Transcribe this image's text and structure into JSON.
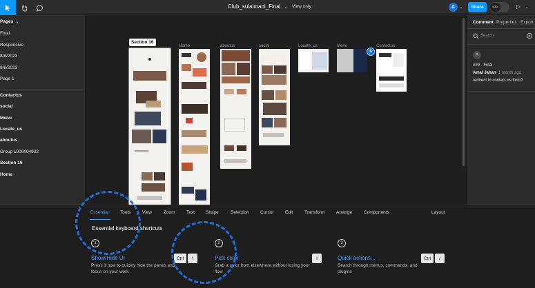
{
  "toolbar": {
    "file_title": "Club_sulaimani_Final",
    "view_mode": "View only",
    "avatar_initial": "A",
    "share_label": "Share",
    "code_icon_text": "</>",
    "accent_color": "#0d99ff"
  },
  "left_panel": {
    "pages_header": "Pages",
    "pages": [
      "Final",
      "Responsive",
      "8/8/2023",
      "9/8/2023",
      "Page 1"
    ],
    "layers": [
      "Contactus",
      "social",
      "Menu",
      "Locate_us",
      "aboutus",
      "Group 1000004932",
      "Section 16",
      "Home"
    ]
  },
  "canvas": {
    "frames": [
      {
        "label": "Section 16",
        "selected": true
      },
      {
        "label": "Home"
      },
      {
        "label": "aboutus"
      },
      {
        "label": "social"
      },
      {
        "label": "Locate_us"
      },
      {
        "label": "Menu"
      },
      {
        "label": "Contactus"
      }
    ],
    "cursor_avatar": "A"
  },
  "right_panel": {
    "tabs": [
      "Comment",
      "Properties",
      "Export"
    ],
    "search_placeholder": "Search",
    "comment": {
      "avatar": "A",
      "ref": "#29 · Final",
      "author": "Amal Jahan",
      "time": "1 month ago",
      "message": "redirect to contact us form?"
    }
  },
  "shortcuts_panel": {
    "tabs": [
      "Essential",
      "Tools",
      "View",
      "Zoom",
      "Text",
      "Shape",
      "Selection",
      "Cursor",
      "Edit",
      "Transform",
      "Arrange",
      "Components"
    ],
    "layout_tab": "Layout",
    "heading": "Essential keyboard shortcuts",
    "items": [
      {
        "num": "1",
        "title": "Show/Hide UI",
        "desc": "Press it now to quickly hide the panes and focus on your work",
        "keys": [
          "Ctrl",
          "\\"
        ]
      },
      {
        "num": "2",
        "title": "Pick color",
        "desc": "Grab a color from elsewhere without losing your flow",
        "keys": [
          "I"
        ]
      },
      {
        "num": "3",
        "title": "Quick actions...",
        "desc": "Search through menus, commands, and plugins",
        "keys": [
          "Ctrl",
          "/"
        ]
      }
    ]
  }
}
